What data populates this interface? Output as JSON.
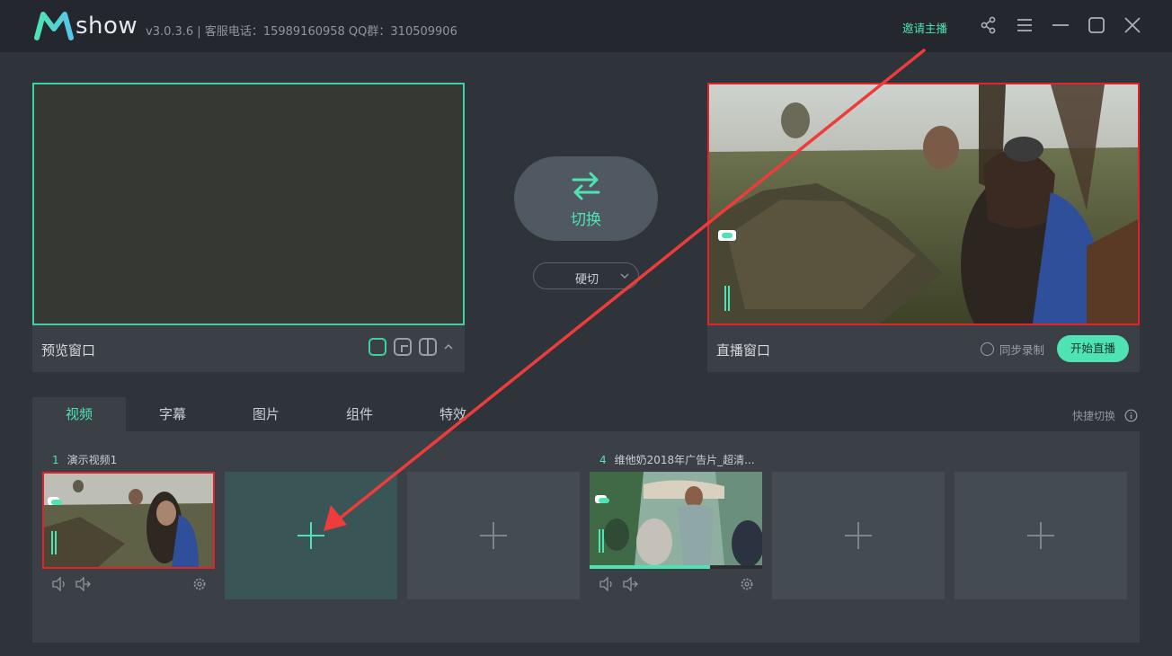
{
  "app": {
    "logo_text": "show",
    "version_info": "v3.0.3.6  |  客服电话：15989160958  QQ群：310509906",
    "invite_label": "邀请主播"
  },
  "preview": {
    "label": "预览窗口"
  },
  "switch": {
    "label": "切换",
    "mode": "硬切"
  },
  "live": {
    "label": "直播窗口",
    "sync_record_label": "同步录制",
    "start_label": "开始直播"
  },
  "tabs": [
    {
      "label": "视频",
      "active": true
    },
    {
      "label": "字幕"
    },
    {
      "label": "图片"
    },
    {
      "label": "组件"
    },
    {
      "label": "特效"
    }
  ],
  "quick_switch_label": "快捷切换",
  "slots": [
    {
      "number": "1",
      "title": "演示视频1"
    },
    {
      "number": "4",
      "title": "维他奶2018年广告片_超清..."
    }
  ],
  "slot4_progress": 0.7,
  "colors": {
    "accent": "#4fe3b3",
    "live_border": "#e2242a",
    "annotation_arrow": "#ee3b3b"
  },
  "icons": [
    "share-icon",
    "menu-icon",
    "minimize-icon",
    "maximize-icon",
    "close-icon",
    "swap-icon",
    "plus-icon",
    "volume-icon",
    "audio-out-icon",
    "settings-icon",
    "info-icon"
  ]
}
